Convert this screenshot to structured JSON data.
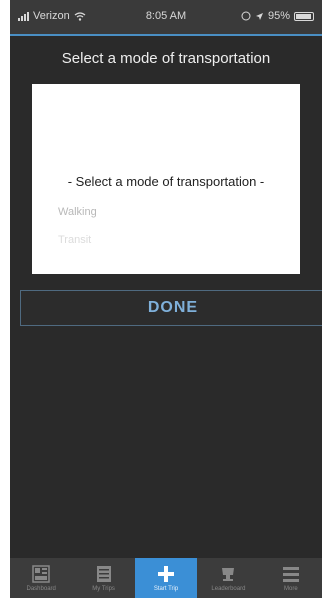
{
  "status": {
    "carrier": "Verizon",
    "time": "8:05 AM",
    "battery_pct": "95%"
  },
  "modal": {
    "title": "Select a mode of transportation",
    "picker_selected": "- Select a mode of transportation -",
    "options": [
      "Walking",
      "Transit"
    ],
    "done_label": "DONE"
  },
  "tabs": [
    {
      "label": "Dashboard",
      "icon": "dashboard-icon",
      "active": false
    },
    {
      "label": "My Trips",
      "icon": "list-icon",
      "active": false
    },
    {
      "label": "Start Trip",
      "icon": "plus-icon",
      "active": true
    },
    {
      "label": "Leaderboard",
      "icon": "trophy-icon",
      "active": false
    },
    {
      "label": "More",
      "icon": "menu-icon",
      "active": false
    }
  ],
  "colors": {
    "accent": "#3b8fd6",
    "background": "#2a2a2a"
  }
}
